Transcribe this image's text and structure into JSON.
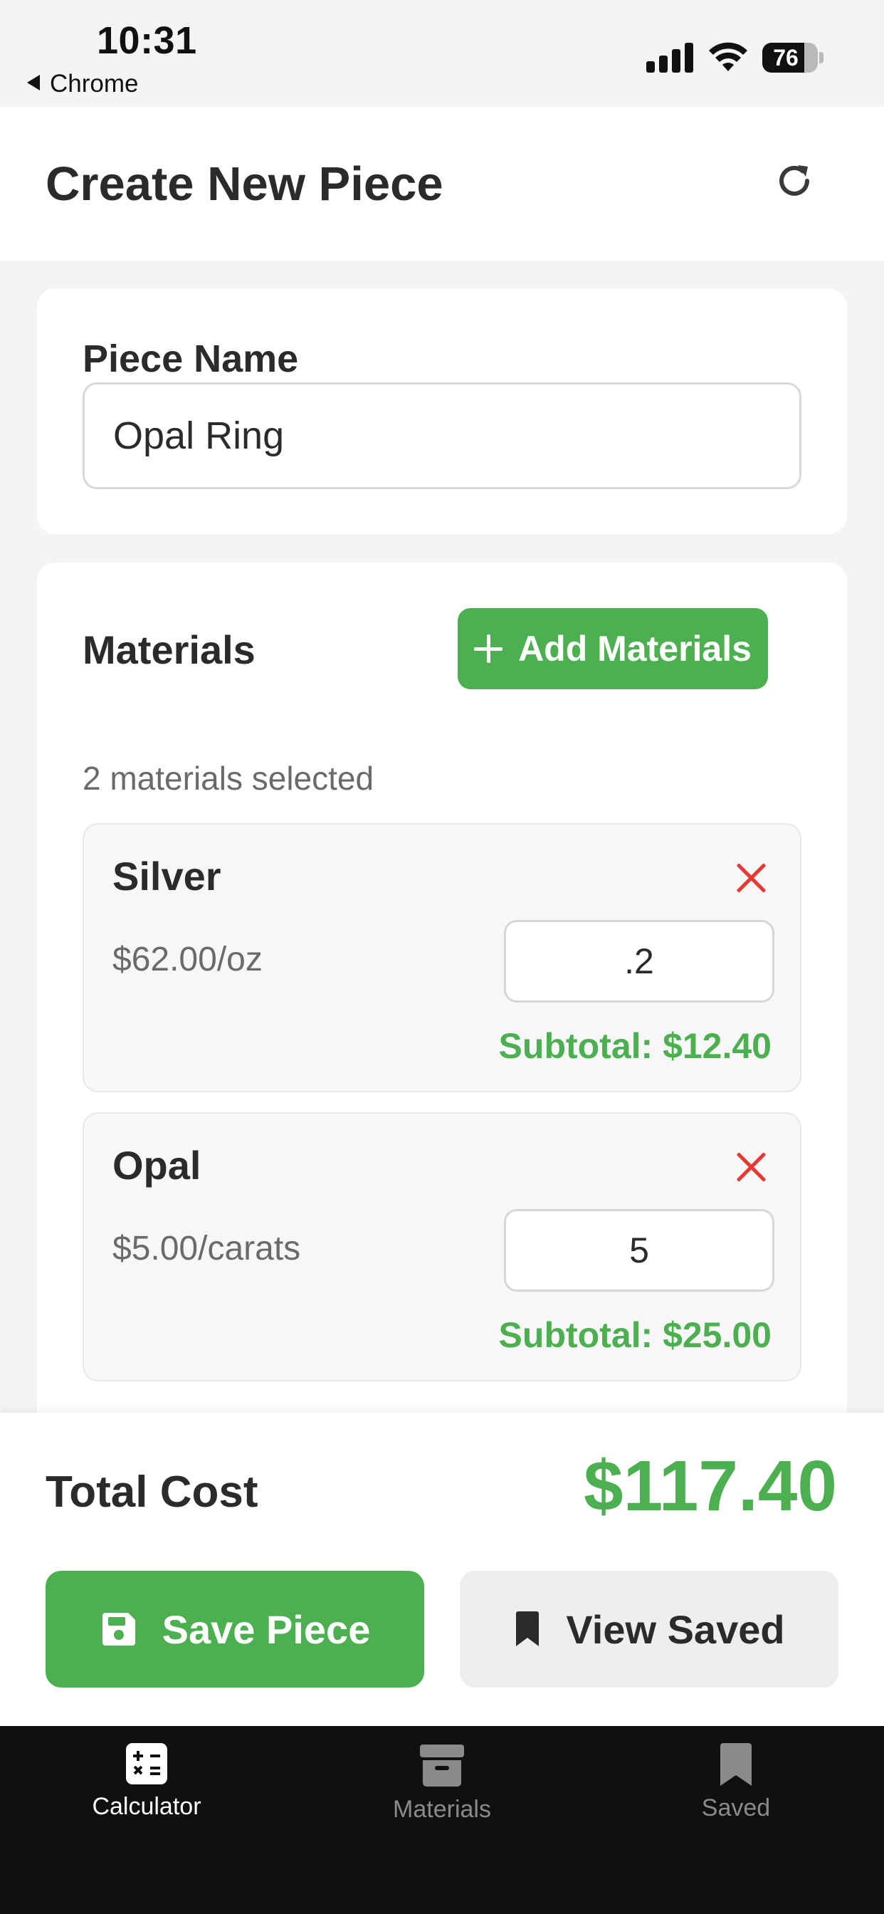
{
  "status_bar": {
    "time": "10:31",
    "back_app": "Chrome",
    "battery": "76",
    "battery_level": 0.76
  },
  "header": {
    "title": "Create New Piece",
    "refresh_icon": "refresh-icon"
  },
  "piece": {
    "label": "Piece Name",
    "value": "Opal Ring"
  },
  "materials": {
    "title": "Materials",
    "add_label": "Add Materials",
    "selected_text": "2 materials selected",
    "items": [
      {
        "name": "Silver",
        "price": "$62.00/oz",
        "quantity": ".2",
        "subtotal": "Subtotal: $12.40"
      },
      {
        "name": "Opal",
        "price": "$5.00/carats",
        "quantity": "5",
        "subtotal": "Subtotal: $25.00"
      }
    ]
  },
  "footer": {
    "total_label": "Total Cost",
    "total_value": "$117.40",
    "save_label": "Save Piece",
    "view_label": "View Saved"
  },
  "tabs": [
    {
      "label": "Calculator",
      "icon": "calculator-icon",
      "active": true
    },
    {
      "label": "Materials",
      "icon": "archive-box-icon",
      "active": false
    },
    {
      "label": "Saved",
      "icon": "bookmark-icon",
      "active": false
    }
  ],
  "colors": {
    "accent": "#4caf50",
    "danger": "#e53935",
    "tab_bar": "#101010",
    "text": "#2b2b2b"
  }
}
